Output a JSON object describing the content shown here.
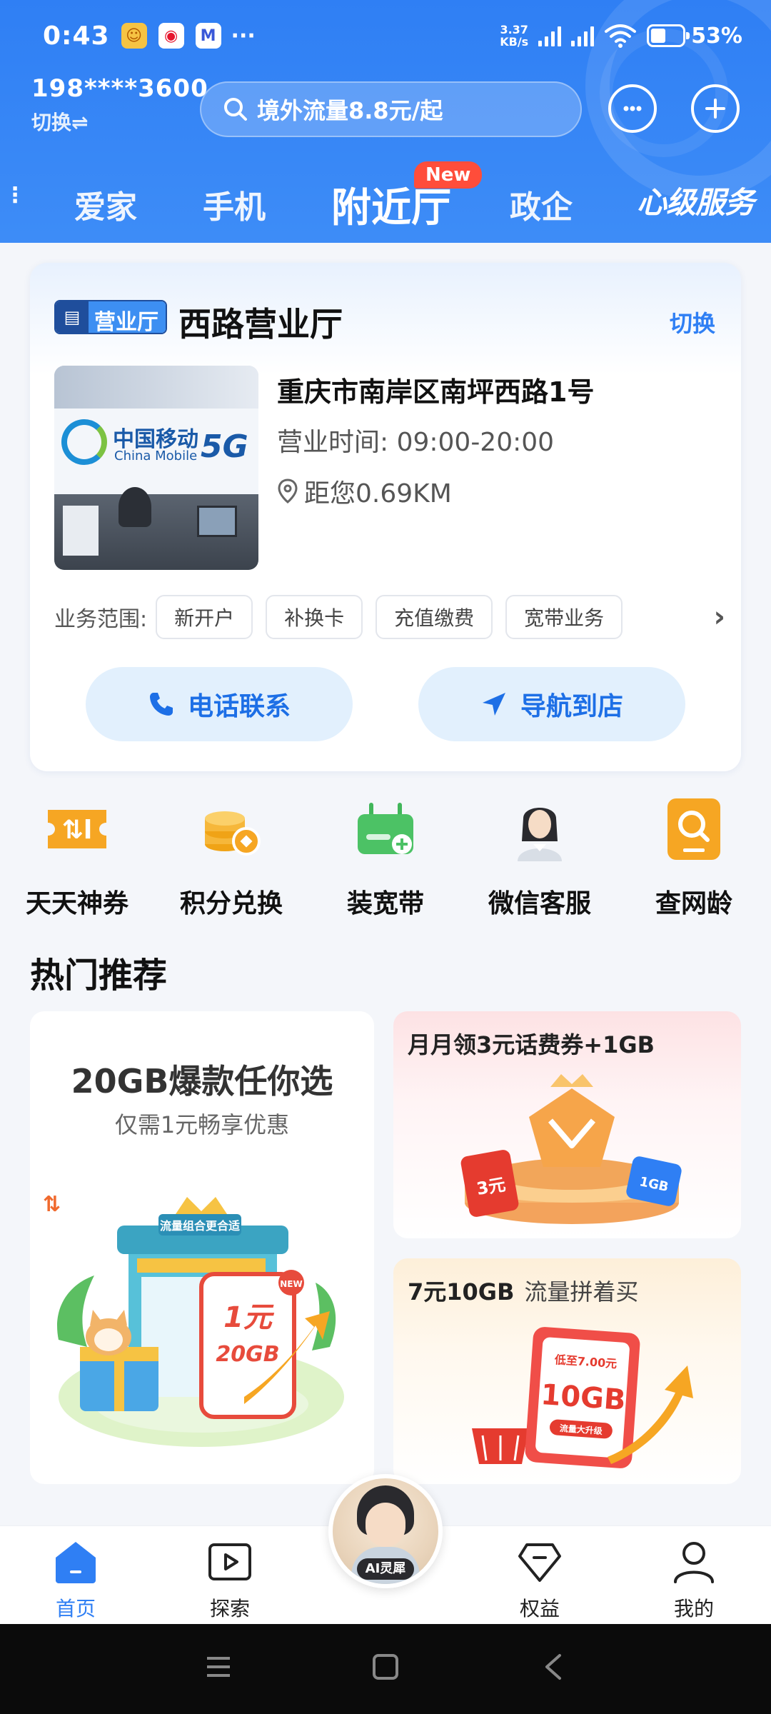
{
  "status_bar": {
    "time": "0:43",
    "more": "···",
    "net_speed_value": "3.37",
    "net_speed_unit": "KB/s",
    "battery": "53%",
    "battery_level": 0.53
  },
  "account": {
    "phone": "198****3600",
    "switch_label": "切换⇌"
  },
  "search": {
    "placeholder": "境外流量8.8元/起"
  },
  "tabs": [
    {
      "label": "爱家"
    },
    {
      "label": "手机"
    },
    {
      "label": "附近厅",
      "active": true,
      "badge": "New"
    },
    {
      "label": "政企"
    },
    {
      "label": "心级服务"
    }
  ],
  "store": {
    "badge_label": "营业厅",
    "name": "西路营业厅",
    "switch_label": "切换",
    "photo_logo_cn": "中国移动",
    "photo_logo_en": "China Mobile",
    "photo_5g": "5G",
    "address": "重庆市南岸区南坪西路1号",
    "hours": "营业时间: 09:00-20:00",
    "distance": "距您0.69KM",
    "scope_label": "业务范围:",
    "services": [
      "新开户",
      "补换卡",
      "充值缴费",
      "宽带业务"
    ],
    "call_label": "电话联系",
    "nav_label": "导航到店"
  },
  "quick_actions": [
    {
      "label": "天天神券",
      "icon": "coupon-icon"
    },
    {
      "label": "积分兑换",
      "icon": "coins-icon"
    },
    {
      "label": "装宽带",
      "icon": "router-icon"
    },
    {
      "label": "微信客服",
      "icon": "agent-avatar"
    },
    {
      "label": "查网龄",
      "icon": "magnifier-phone-icon"
    }
  ],
  "hot": {
    "title": "热门推荐",
    "big": {
      "title": "20GB爆款任你选",
      "subtitle": "仅需1元畅享优惠",
      "sign": "流量组合更合适",
      "price": "1元",
      "data": "20GB",
      "tag": "NEW"
    },
    "card1": {
      "title": "月月领3元话费券+1GB",
      "coupon": "3元",
      "ticket": "1GB"
    },
    "card2": {
      "title": "7元10GB",
      "subtitle": "流量拼着买",
      "tag_top": "低至7.00元",
      "tag_main": "10GB",
      "tag_bottom": "流量大升级"
    }
  },
  "bottom_nav": [
    {
      "label": "首页",
      "active": true
    },
    {
      "label": "探索"
    },
    {
      "label": "AI灵犀"
    },
    {
      "label": "权益"
    },
    {
      "label": "我的"
    }
  ],
  "colors": {
    "primary": "#2f7ff4",
    "header": "#3d8cf7",
    "badge_red": "#ff4d3a",
    "accent_orange": "#f6a623"
  }
}
